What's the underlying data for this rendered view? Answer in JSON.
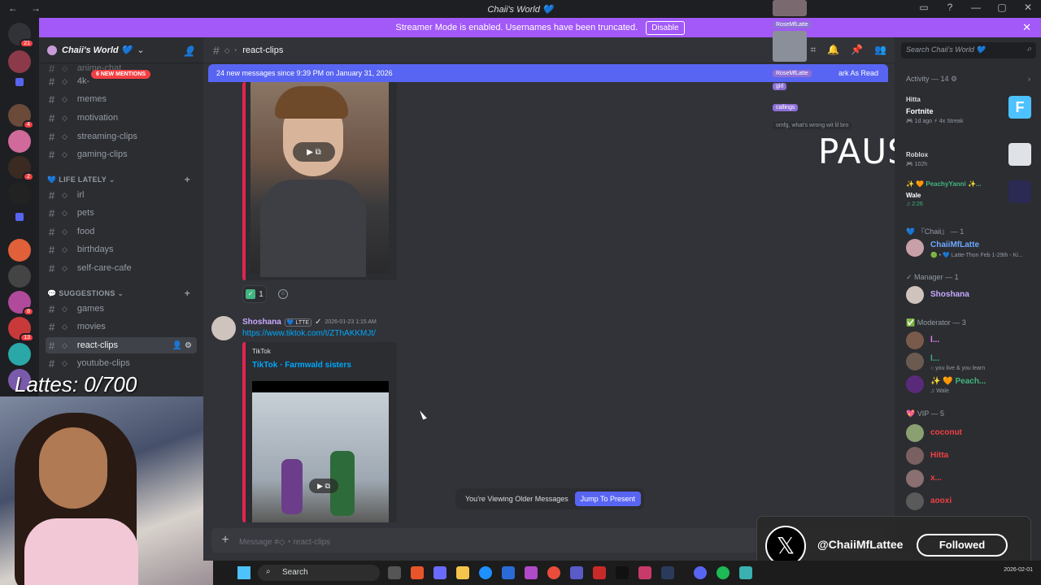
{
  "window": {
    "title": "Chaii's World 💙"
  },
  "streamer_banner": {
    "text": "Streamer Mode is enabled. Usernames have been truncated.",
    "button": "Disable"
  },
  "guild": {
    "name": "Chaii's World 💙",
    "mentions_pill": "6 NEW MENTIONS"
  },
  "channels_top": [
    {
      "name": "anime-chat"
    },
    {
      "name": "4k-"
    },
    {
      "name": "memes"
    },
    {
      "name": "motivation"
    },
    {
      "name": "streaming-clips"
    },
    {
      "name": "gaming-clips"
    }
  ],
  "category_life": "💙 LIFE LATELY ⌄",
  "channels_life": [
    {
      "name": "irl"
    },
    {
      "name": "pets"
    },
    {
      "name": "food"
    },
    {
      "name": "birthdays"
    },
    {
      "name": "self-care-cafe"
    }
  ],
  "category_suggestions": "💬 SUGGESTIONS ⌄",
  "channels_suggestions": [
    {
      "name": "games"
    },
    {
      "name": "movies"
    },
    {
      "name": "react-clips"
    },
    {
      "name": "youtube-clips"
    }
  ],
  "overlay": {
    "lattes": "Lattes: 0/700",
    "paused": "PAUSED"
  },
  "chat": {
    "channel": "react-clips",
    "new_messages": "24 new messages since 9:39 PM on January 31, 2026",
    "mark_read": "ark As Read",
    "reaction_count": "1",
    "author": "Shoshana",
    "author_tag": "💙 LTTE",
    "timestamp": "2026-01-23 1:15 AM",
    "link": "https://www.tiktok.com/t/ZThAKKMJt/",
    "embed_provider": "TikTok",
    "embed_title": "TikTok · Farmwald sisters",
    "older_notice": "You're Viewing Older Messages",
    "jump_button": "Jump To Present",
    "composer_placeholder": "Message #◇・react-clips"
  },
  "overlay_chat": [
    {
      "text": "RoseMfLatte"
    },
    {
      "text": "RoseMfLatte"
    },
    {
      "text": "girl"
    },
    {
      "text": "callings"
    },
    {
      "text": "omfg, what's wrong wit lil bro"
    }
  ],
  "members": {
    "search_placeholder": "Search Chaii's World 💙",
    "activity_header": "Activity — 14 ⚙",
    "activities": [
      {
        "name": "Hitta",
        "game": "Fortnite",
        "meta": "🎮 1d ago  ⚡ 4x Streak",
        "color": "#c84fff"
      },
      {
        "name": "",
        "game": "Roblox",
        "meta": "🎮 102h",
        "color": "#dbdee1"
      },
      {
        "name": "✨ 🧡 PeachyYanni ✨...",
        "game": "Wale",
        "meta": "♫ 2:26",
        "color": "#43b581"
      }
    ],
    "groups": [
      {
        "header": "💙 『Chaii』 — 1",
        "members": [
          {
            "name": "ChaiiMfLatte",
            "sub": "🟢 • 💙 Latte-Thon Feb 1-29th - Ki...",
            "color": "#6ea8ff"
          }
        ]
      },
      {
        "header": "✓ Manager — 1",
        "members": [
          {
            "name": "Shoshana",
            "sub": "",
            "color": "#c8a8ff"
          }
        ]
      },
      {
        "header": "✅ Moderator — 3",
        "members": [
          {
            "name": "l...",
            "sub": "",
            "color": "#f47fff"
          },
          {
            "name": "l...",
            "sub": "○ you live & you learn",
            "color": "#43b581"
          },
          {
            "name": "✨ 🧡 Peach...",
            "sub": "♫ Wale",
            "color": "#43b581"
          }
        ]
      },
      {
        "header": "💖 VIP — 5",
        "members": [
          {
            "name": "coconut",
            "sub": "",
            "color": "#f23f43"
          },
          {
            "name": "Hitta",
            "sub": "",
            "color": "#f23f43"
          },
          {
            "name": "x...",
            "sub": "",
            "color": "#f23f43"
          },
          {
            "name": "aooxi",
            "sub": "",
            "color": "#f23f43"
          }
        ]
      }
    ]
  },
  "x_banner": {
    "handle": "@ChaiiMfLattee",
    "button": "Followed"
  },
  "taskbar": {
    "search": "Search",
    "clock": "2026-02-01"
  },
  "colors": {
    "accent": "#5865f2",
    "streamer": "#a259f7",
    "embed": "#e4234f"
  }
}
